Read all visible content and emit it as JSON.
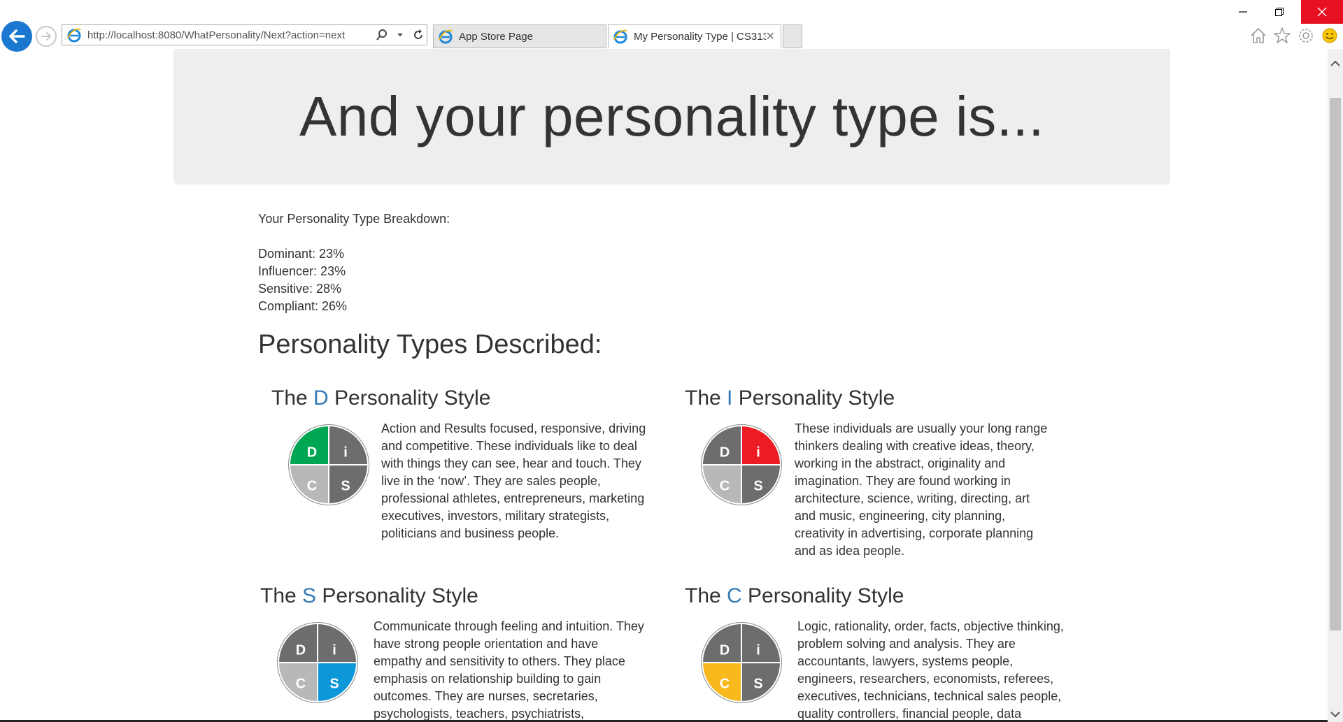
{
  "browser": {
    "url": "http://localhost:8080/WhatPersonality/Next?action=next",
    "tabs": [
      {
        "label": "App Store Page",
        "active": false
      },
      {
        "label": "My Personality Type | CS313...",
        "active": true
      }
    ],
    "new_tab_label": ""
  },
  "page": {
    "heading": "And your personality type is...",
    "breakdown": {
      "title": "Your Personality Type Breakdown:",
      "items": [
        {
          "label": "Dominant: 23%"
        },
        {
          "label": "Influencer: 23%"
        },
        {
          "label": "Sensitive: 28%"
        },
        {
          "label": "Compliant: 26%"
        }
      ]
    },
    "types_heading": "Personality Types Described:",
    "styles": [
      {
        "prefix": "The ",
        "letter": "D",
        "suffix": " Personality Style",
        "highlight": "D",
        "highlight_color": "#00a651",
        "description": "Action and Results focused, responsive, driving and competitive. These individuals like to deal with things they can see, hear and touch. They live in the ‘now’. They are sales people, professional athletes, entrepreneurs, marketing executives, investors, military strategists, politicians and business people."
      },
      {
        "prefix": "The ",
        "letter": "I",
        "suffix": " Personality Style",
        "highlight": "i",
        "highlight_color": "#ed1c24",
        "description": "These individuals are usually your long range thinkers dealing with creative ideas, theory, working in the abstract, originality and imagination. They are found working in architecture, science, writing, directing, art and music, engineering, city planning, creativity in advertising, corporate planning and as idea people."
      },
      {
        "prefix": "The ",
        "letter": "S",
        "suffix": " Personality Style",
        "highlight": "S",
        "highlight_color": "#0b97d8",
        "description": "Communicate through feeling and intuition. They have strong people orientation and have empathy and sensitivity to others. They place emphasis on relationship building to gain outcomes. They are nurses, secretaries, psychologists, teachers, psychiatrists, counselors, hairdressers,"
      },
      {
        "prefix": "The ",
        "letter": "C",
        "suffix": " Personality Style",
        "highlight": "C",
        "highlight_color": "#f9b81b",
        "description": "Logic, rationality, order, facts, objective thinking, problem solving and analysis. They are accountants, lawyers, systems people, engineers, researchers, economists, referees, executives, technicians, technical sales people, quality controllers, financial people, data processing"
      }
    ],
    "disc_letters": {
      "d": "D",
      "i": "i",
      "c": "C",
      "s": "S"
    },
    "disc_colors": {
      "dark": "#6d6d6d",
      "light": "#b8b8b8"
    }
  }
}
